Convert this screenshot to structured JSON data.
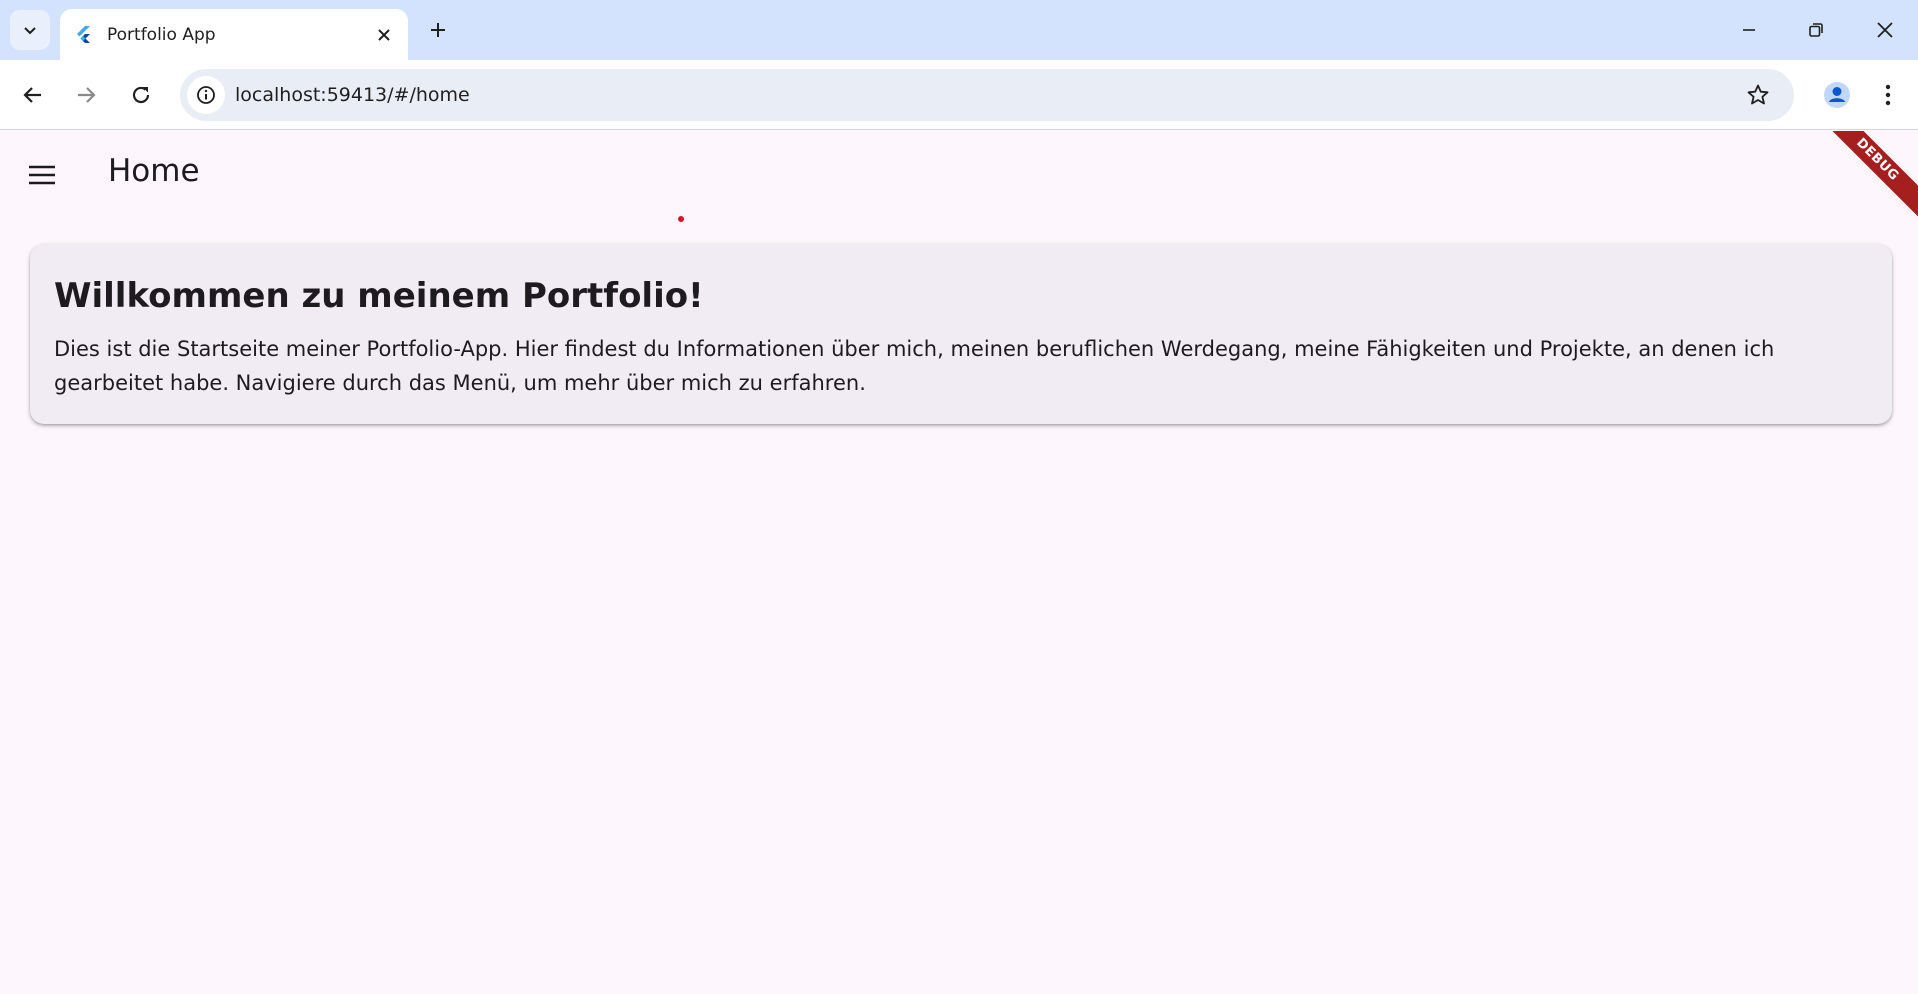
{
  "browser": {
    "tab": {
      "title": "Portfolio App",
      "favicon": "flutter-icon"
    },
    "address_bar": {
      "url": "localhost:59413/#/home"
    },
    "icons": {
      "tab_search": "chevron-down-icon",
      "tab_close": "close-icon",
      "new_tab": "plus-icon",
      "minimize": "minimize-icon",
      "restore": "restore-icon",
      "close": "close-icon",
      "back": "back-arrow-icon",
      "forward": "forward-arrow-icon",
      "reload": "reload-icon",
      "site_info": "info-icon",
      "bookmark": "star-icon",
      "profile": "person-icon",
      "menu": "kebab-menu-icon"
    }
  },
  "app": {
    "appbar": {
      "title": "Home",
      "menu_icon": "hamburger-icon"
    },
    "debug_banner": "DEBUG",
    "card": {
      "title": "Willkommen zu meinem Portfolio!",
      "text": "Dies ist die Startseite meiner Portfolio-App. Hier findest du Informationen über mich, meinen beruflichen Werdegang, meine Fähigkeiten und Projekte, an denen ich gearbeitet habe. Navigiere durch das Menü, um mehr über mich zu erfahren."
    }
  },
  "colors": {
    "tabstrip": "#d3e3fd",
    "page_background": "#fdf7fd",
    "card_background": "#f1ecf4",
    "debug_ribbon": "#a51f1f"
  }
}
